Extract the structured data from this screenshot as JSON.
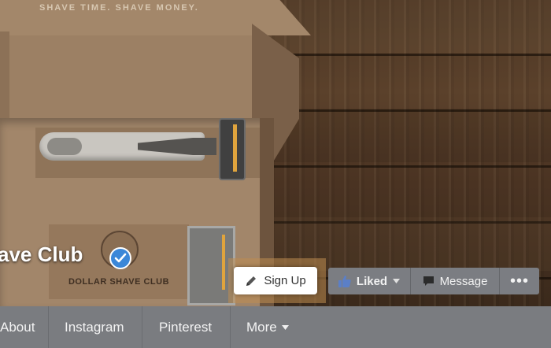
{
  "cover": {
    "box_lid_text": "SHAVE TIME. SHAVE MONEY.",
    "box_brand_text": "DOLLAR SHAVE CLUB"
  },
  "page": {
    "name": "ave Club",
    "verified_icon": "check-icon"
  },
  "actions": {
    "signup_label": "Sign Up",
    "signup_icon": "pencil-icon",
    "liked_label": "Liked",
    "liked_icon": "thumbs-up-icon",
    "message_label": "Message",
    "message_icon": "speech-bubble-icon",
    "more_label": "•••"
  },
  "nav": {
    "items": [
      {
        "label": "About"
      },
      {
        "label": "Instagram"
      },
      {
        "label": "Pinterest"
      },
      {
        "label": "More"
      }
    ]
  },
  "colors": {
    "verified_blue": "#3b87d8",
    "liked_blue": "#3b5998",
    "action_bar": "#7b7d82",
    "nav_bar": "#7a7c80"
  }
}
